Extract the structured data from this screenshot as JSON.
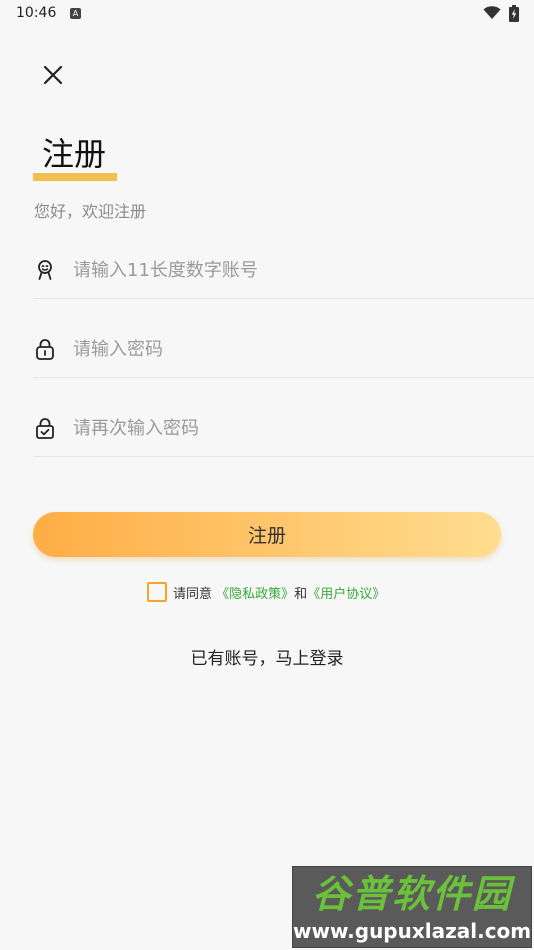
{
  "status_bar": {
    "time": "10:46",
    "notification_icon_letter": "A",
    "wifi_icon": "wifi-icon",
    "battery_icon": "battery-charging-icon"
  },
  "header": {
    "close_icon": "close-icon",
    "title": "注册",
    "subtitle": "您好，欢迎注册"
  },
  "form": {
    "account": {
      "icon": "user-icon",
      "placeholder": "请输入11长度数字账号",
      "value": ""
    },
    "password": {
      "icon": "lock-icon",
      "placeholder": "请输入密码",
      "value": ""
    },
    "confirm_password": {
      "icon": "lock-check-icon",
      "placeholder": "请再次输入密码",
      "value": ""
    },
    "submit_label": "注册"
  },
  "agreement": {
    "checked": false,
    "prefix": "请同意",
    "privacy_link": "《隐私政策》",
    "joiner": "和",
    "terms_link": "《用户协议》"
  },
  "login_prompt": "已有账号，马上登录",
  "watermark": {
    "logo_text": "谷普软件园",
    "url": "www.gupuxlazal.com"
  },
  "colors": {
    "background": "#f7f7f7",
    "accent_underline": "#f3c050",
    "button_gradient_start": "#ffad45",
    "button_gradient_end": "#ffdd8f",
    "checkbox_border": "#f5a623",
    "link_green": "#3aa83a"
  }
}
